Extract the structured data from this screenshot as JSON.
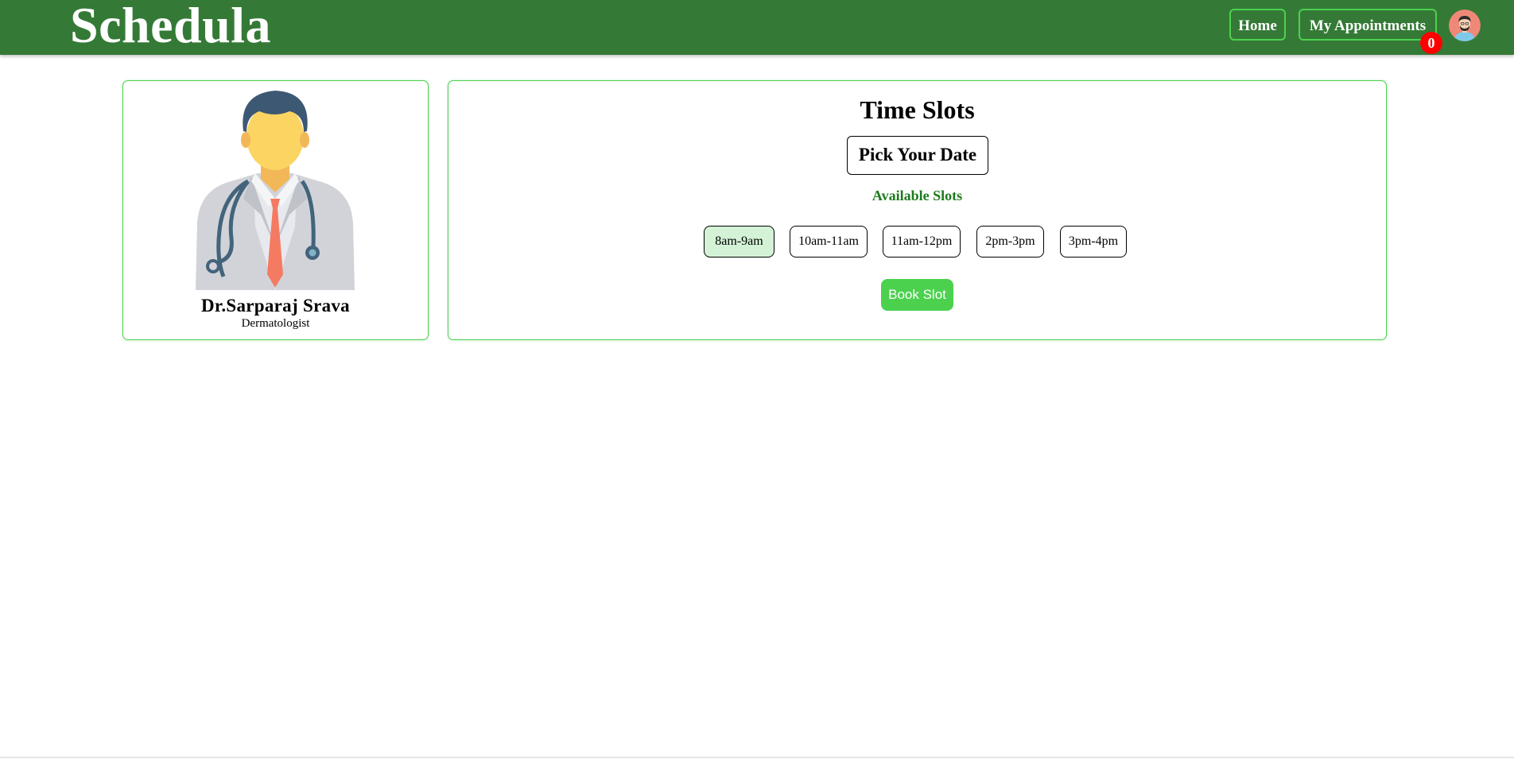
{
  "nav": {
    "brand": "Schedula",
    "home_label": "Home",
    "appointments_label": "My Appointments",
    "appointments_count": "0"
  },
  "doctor": {
    "name": "Dr.Sarparaj Srava",
    "specialty": "Dermatologist"
  },
  "slots": {
    "title": "Time Slots",
    "date_picker_label": "Pick Your Date",
    "available_label": "Available Slots",
    "items": [
      {
        "label": "8am-9am",
        "selected": true
      },
      {
        "label": "10am-11am",
        "selected": false
      },
      {
        "label": "11am-12pm",
        "selected": false
      },
      {
        "label": "2pm-3pm",
        "selected": false
      },
      {
        "label": "3pm-4pm",
        "selected": false
      }
    ],
    "book_label": "Book Slot"
  },
  "colors": {
    "navbar": "#347a36",
    "accent": "#4cd14f",
    "available_text": "#1e7a1e",
    "badge": "#ff0000",
    "selected_slot": "#d4f3d6"
  }
}
